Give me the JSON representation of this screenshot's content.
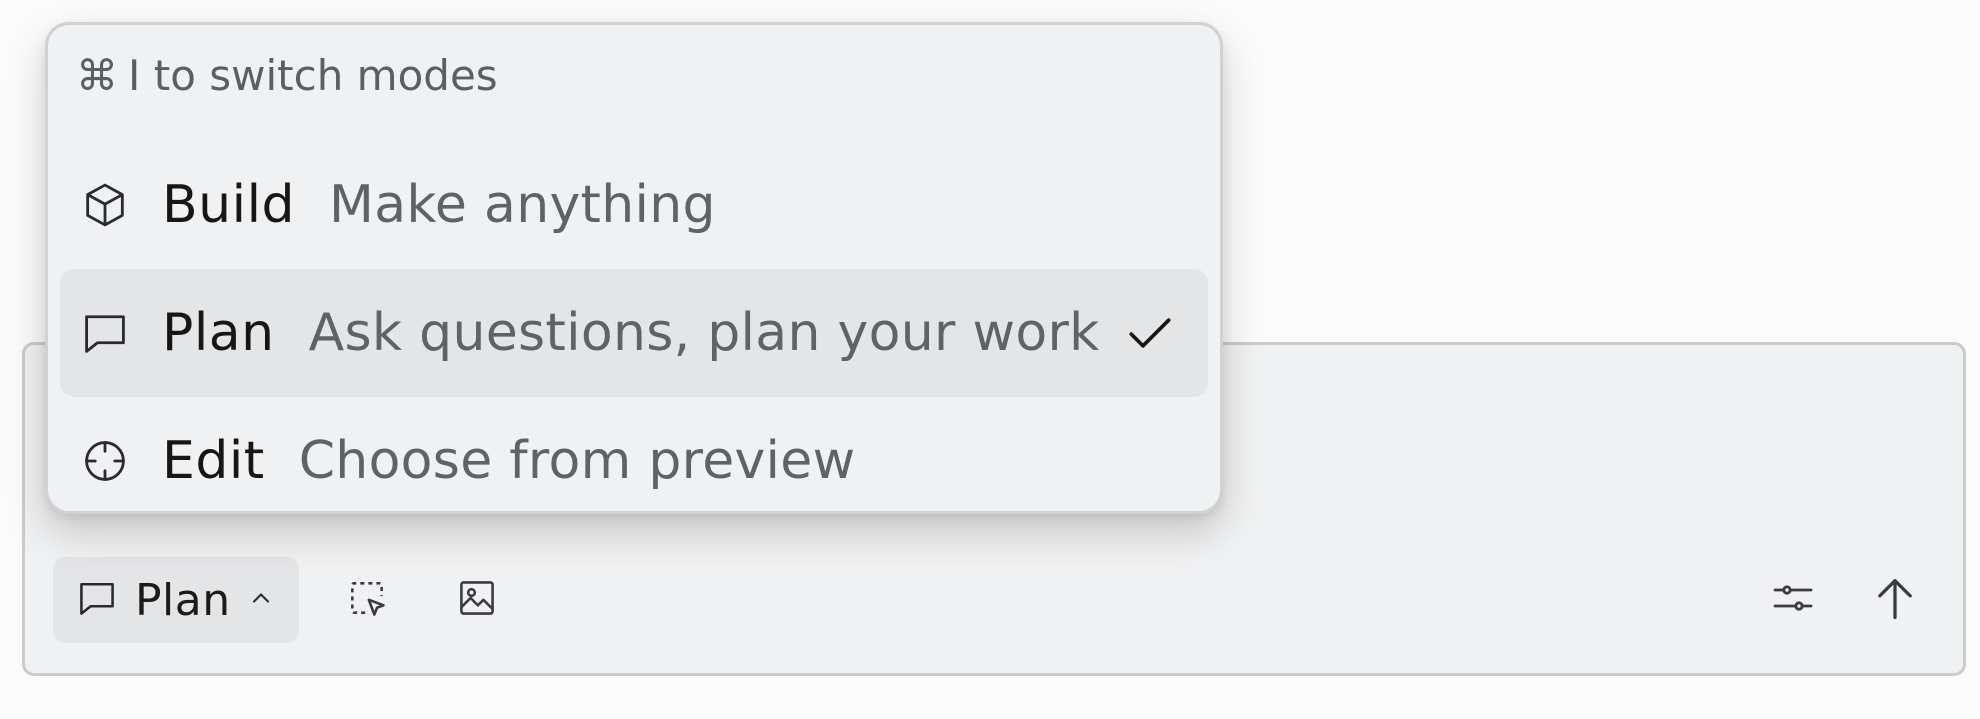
{
  "popover": {
    "hint_key": "⌘",
    "hint_text": "I to switch modes",
    "modes": [
      {
        "title": "Build",
        "description": "Make anything",
        "icon": "cube-icon",
        "selected": false
      },
      {
        "title": "Plan",
        "description": "Ask questions, plan your work",
        "icon": "chat-bubble-icon",
        "selected": true
      },
      {
        "title": "Edit",
        "description": "Choose from preview",
        "icon": "crosshair-icon",
        "selected": false
      }
    ]
  },
  "composer": {
    "mode_chip_label": "Plan",
    "mode_chip_icon": "chat-bubble-icon",
    "tools": [
      "select-element-icon",
      "image-icon"
    ],
    "right_tools": [
      "settings-sliders-icon",
      "send-arrow-icon"
    ]
  },
  "colors": {
    "surface": "#f0f1f2",
    "selected": "#e4e5e7",
    "text_primary": "#161617",
    "text_secondary": "#5f6268"
  }
}
